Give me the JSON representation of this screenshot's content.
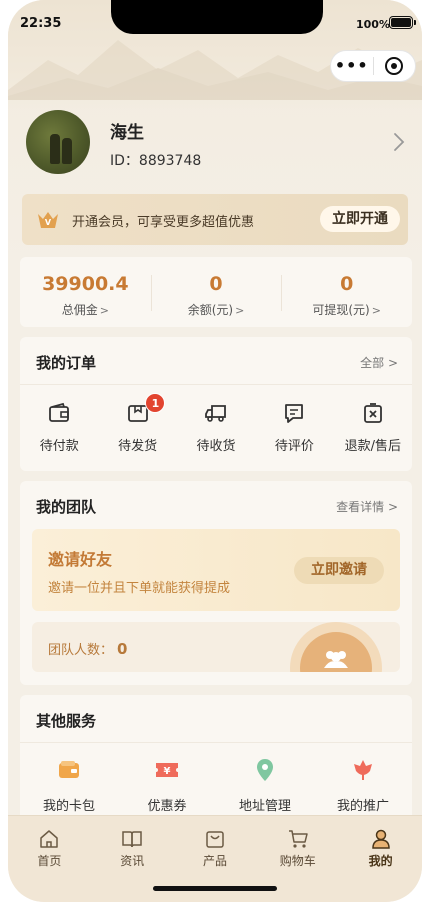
{
  "status_bar": {
    "time": "22:35",
    "battery": "100%"
  },
  "capsule": {
    "more_icon": "more-dots-icon",
    "close_icon": "close-target-icon"
  },
  "profile": {
    "name": "海生",
    "id_text": "ID：8893748"
  },
  "vip": {
    "text": "开通会员，可享受更多超值优惠",
    "button": "立即开通"
  },
  "stats": [
    {
      "value": "39900.4",
      "label": "总佣金"
    },
    {
      "value": "0",
      "label": "余额(元)"
    },
    {
      "value": "0",
      "label": "可提现(元)"
    }
  ],
  "orders": {
    "title": "我的订单",
    "link": "全部",
    "items": [
      {
        "label": "待付款",
        "icon": "wallet-icon"
      },
      {
        "label": "待发货",
        "icon": "package-icon",
        "badge": "1"
      },
      {
        "label": "待收货",
        "icon": "truck-icon"
      },
      {
        "label": "待评价",
        "icon": "comment-icon"
      },
      {
        "label": "退款/售后",
        "icon": "refund-icon"
      }
    ]
  },
  "team": {
    "title": "我的团队",
    "link": "查看详情",
    "invite_title": "邀请好友",
    "invite_sub": "邀请一位并且下单就能获得提成",
    "invite_button": "立即邀请",
    "count_label": "团队人数：",
    "count_value": "0"
  },
  "services": {
    "title": "其他服务",
    "items": [
      {
        "label": "我的卡包",
        "icon": "card-wallet-icon"
      },
      {
        "label": "优惠券",
        "icon": "coupon-icon"
      },
      {
        "label": "地址管理",
        "icon": "location-icon"
      },
      {
        "label": "我的推广",
        "icon": "flower-icon"
      }
    ]
  },
  "tabbar": [
    {
      "label": "首页",
      "icon": "home-icon"
    },
    {
      "label": "资讯",
      "icon": "book-icon"
    },
    {
      "label": "产品",
      "icon": "product-icon"
    },
    {
      "label": "购物车",
      "icon": "cart-icon"
    },
    {
      "label": "我的",
      "icon": "user-icon",
      "active": true
    }
  ],
  "colors": {
    "accent": "#c87a33",
    "badge": "#e2442f",
    "background": "#f4efe6"
  }
}
